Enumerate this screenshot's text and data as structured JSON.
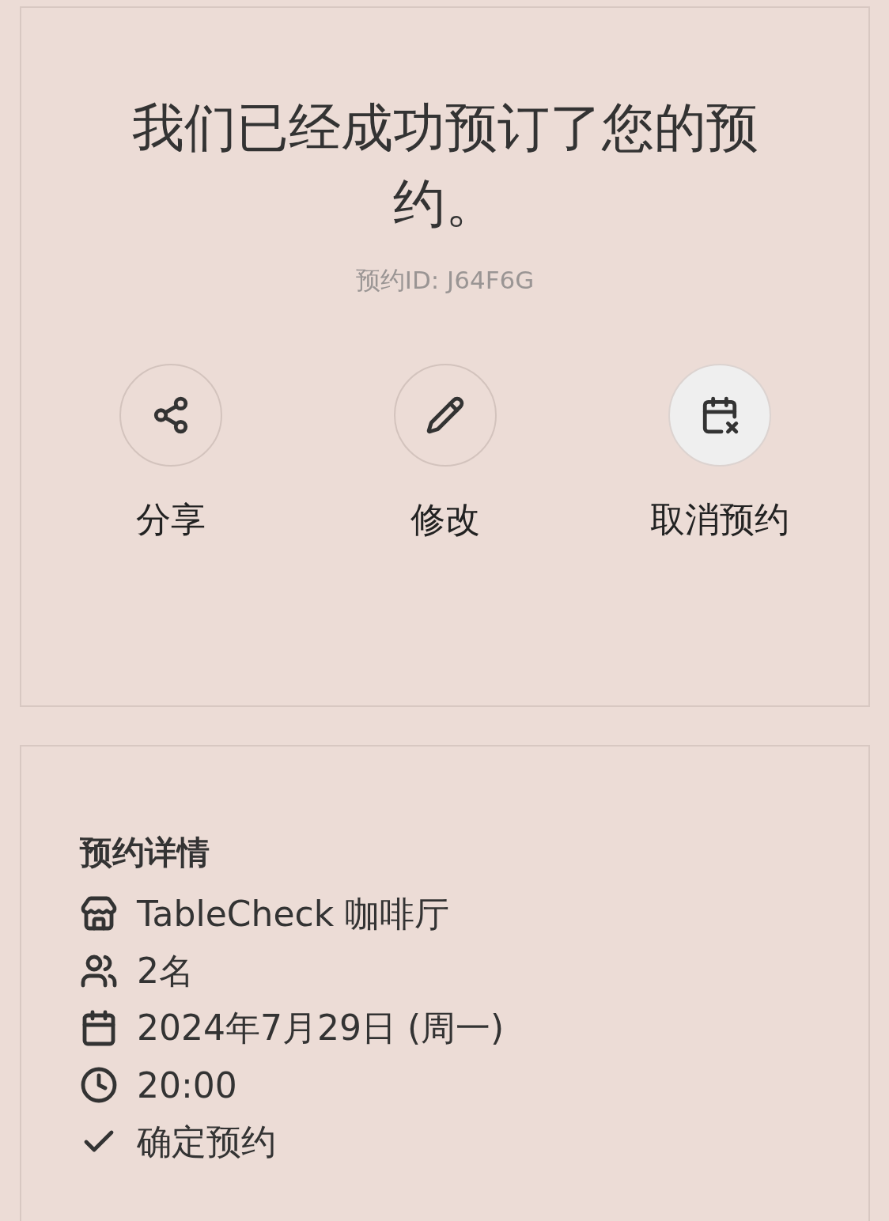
{
  "confirmation": {
    "title": "我们已经成功预订了您的预约。",
    "reservation_id": "预约ID: J64F6G",
    "actions": [
      {
        "kind": "share",
        "label": "分享",
        "pressed": false
      },
      {
        "kind": "edit",
        "label": "修改",
        "pressed": false
      },
      {
        "kind": "cancel",
        "label": "取消预约",
        "pressed": true
      }
    ]
  },
  "details": {
    "heading": "预约详情",
    "items": [
      {
        "kind": "venue",
        "text": "TableCheck 咖啡厅"
      },
      {
        "kind": "guests",
        "text": "2名"
      },
      {
        "kind": "date",
        "text": "2024年7月29日 (周一)"
      },
      {
        "kind": "time",
        "text": "20:00"
      },
      {
        "kind": "status",
        "text": "确定预约"
      }
    ]
  }
}
